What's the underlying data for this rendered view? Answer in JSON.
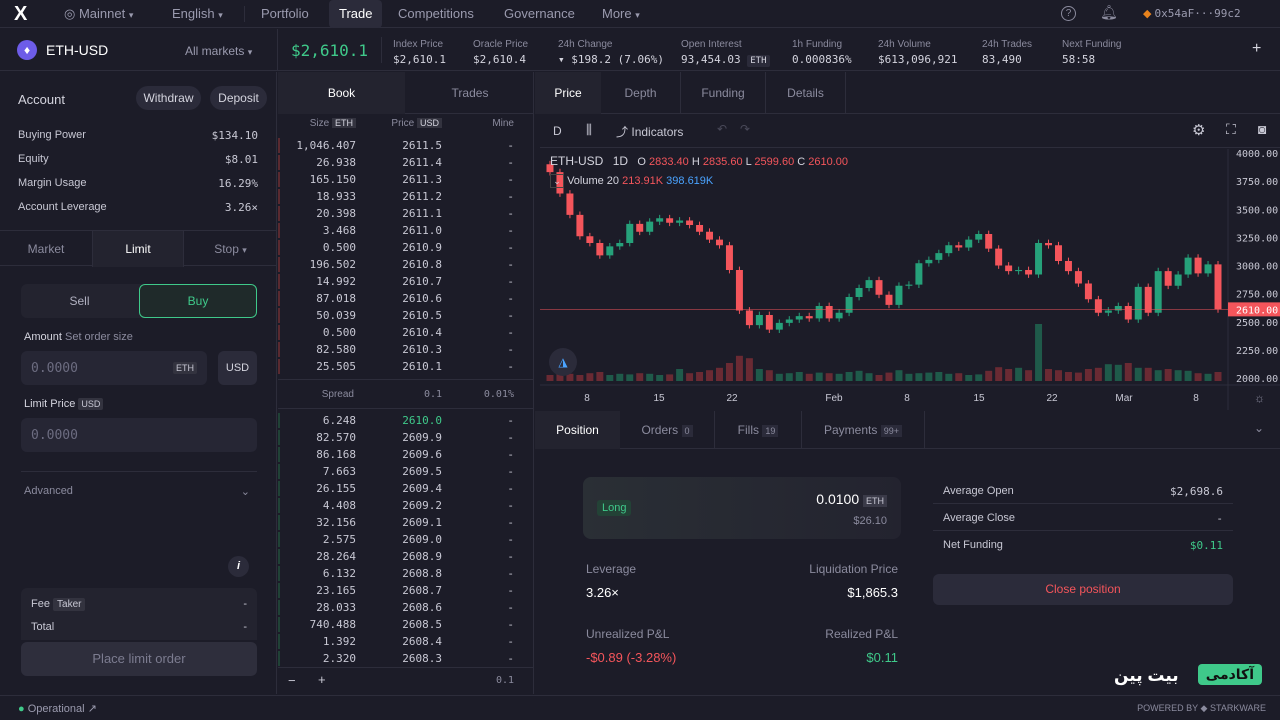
{
  "nav": {
    "network": "Mainnet",
    "language": "English",
    "items": [
      "Portfolio",
      "Trade",
      "Competitions",
      "Governance",
      "More"
    ],
    "wallet": "0x54aF···99c2"
  },
  "market": {
    "pair": "ETH-USD",
    "all_markets": "All markets",
    "price": "$2,610.1",
    "stats": [
      {
        "label": "Index Price",
        "value": "$2,610.1"
      },
      {
        "label": "Oracle Price",
        "value": "$2,610.4"
      },
      {
        "label": "24h Change",
        "value": "▾ $198.2 (7.06%)"
      },
      {
        "label": "Open Interest",
        "value": "93,454.03",
        "unit": "ETH"
      },
      {
        "label": "1h Funding",
        "value": "0.000836%"
      },
      {
        "label": "24h Volume",
        "value": "$613,096,921"
      },
      {
        "label": "24h Trades",
        "value": "83,490"
      },
      {
        "label": "Next Funding",
        "value": "58:58"
      }
    ]
  },
  "account": {
    "title": "Account",
    "withdraw": "Withdraw",
    "deposit": "Deposit",
    "rows": [
      {
        "k": "Buying Power",
        "v": "$134.10"
      },
      {
        "k": "Equity",
        "v": "$8.01"
      },
      {
        "k": "Margin Usage",
        "v": "16.29%"
      },
      {
        "k": "Account Leverage",
        "v": "3.26×"
      }
    ]
  },
  "order": {
    "tabs": [
      "Market",
      "Limit",
      "Stop"
    ],
    "sell": "Sell",
    "buy": "Buy",
    "amount_label": "Amount",
    "amount_hint": "Set order size",
    "amount_placeholder": "0.0000",
    "eth": "ETH",
    "usd": "USD",
    "limit_label": "Limit Price",
    "limit_unit": "USD",
    "limit_placeholder": "0.0000",
    "advanced": "Advanced",
    "fee": "Fee",
    "taker": "Taker",
    "fee_val": "-",
    "total": "Total",
    "total_val": "-",
    "place": "Place limit order"
  },
  "book": {
    "tabs": [
      "Book",
      "Trades"
    ],
    "h_size": "Size",
    "h_size_unit": "ETH",
    "h_price": "Price",
    "h_price_unit": "USD",
    "h_mine": "Mine",
    "asks": [
      [
        "1,046.407",
        "2611.5"
      ],
      [
        "26.938",
        "2611.4"
      ],
      [
        "165.150",
        "2611.3"
      ],
      [
        "18.933",
        "2611.2"
      ],
      [
        "20.398",
        "2611.1"
      ],
      [
        "3.468",
        "2611.0"
      ],
      [
        "0.500",
        "2610.9"
      ],
      [
        "196.502",
        "2610.8"
      ],
      [
        "14.992",
        "2610.7"
      ],
      [
        "87.018",
        "2610.6"
      ],
      [
        "50.039",
        "2610.5"
      ],
      [
        "0.500",
        "2610.4"
      ],
      [
        "82.580",
        "2610.3"
      ],
      [
        "25.505",
        "2610.1"
      ]
    ],
    "spread_label": "Spread",
    "spread": "0.1",
    "spread_pct": "0.01%",
    "bids": [
      [
        "6.248",
        "2610.0"
      ],
      [
        "82.570",
        "2609.9"
      ],
      [
        "86.168",
        "2609.6"
      ],
      [
        "7.663",
        "2609.5"
      ],
      [
        "26.155",
        "2609.4"
      ],
      [
        "4.408",
        "2609.2"
      ],
      [
        "32.156",
        "2609.1"
      ],
      [
        "2.575",
        "2609.0"
      ],
      [
        "28.264",
        "2608.9"
      ],
      [
        "6.132",
        "2608.8"
      ],
      [
        "23.165",
        "2608.7"
      ],
      [
        "28.033",
        "2608.6"
      ],
      [
        "740.488",
        "2608.5"
      ],
      [
        "1.392",
        "2608.4"
      ],
      [
        "2.320",
        "2608.3"
      ]
    ],
    "mine": "-",
    "tick": "0.1"
  },
  "chart": {
    "tabs": [
      "Price",
      "Depth",
      "Funding",
      "Details"
    ],
    "interval": "D",
    "indicators": "Indicators",
    "symbol": "ETH-USD",
    "tf": "1D",
    "ohlc": {
      "o": "2833.40",
      "h": "2835.60",
      "l": "2599.60",
      "c": "2610.00"
    },
    "vol_label": "Volume 20",
    "vol1": "213.91K",
    "vol2": "398.619K",
    "yticks": [
      "4000.00",
      "3750.00",
      "3500.00",
      "3250.00",
      "3000.00",
      "2750.00",
      "2500.00",
      "2250.00",
      "2000.00"
    ],
    "last": "2610.00",
    "xticks": [
      "8",
      "15",
      "22",
      "Feb",
      "8",
      "15",
      "22",
      "Mar",
      "8"
    ]
  },
  "chart_data": {
    "type": "candlestick",
    "ylim": [
      2000,
      4000
    ],
    "closes": [
      3830,
      3640,
      3450,
      3260,
      3200,
      3090,
      3170,
      3200,
      3370,
      3300,
      3390,
      3420,
      3380,
      3400,
      3360,
      3300,
      3230,
      3180,
      2960,
      2600,
      2470,
      2560,
      2430,
      2490,
      2520,
      2550,
      2530,
      2640,
      2530,
      2580,
      2720,
      2800,
      2870,
      2740,
      2650,
      2820,
      2830,
      3020,
      3050,
      3110,
      3180,
      3160,
      3230,
      3280,
      3150,
      3000,
      2950,
      2960,
      2920,
      3200,
      3180,
      3040,
      2950,
      2840,
      2700,
      2580,
      2600,
      2640,
      2520,
      2810,
      2580,
      2950,
      2820,
      2920,
      3070,
      2930,
      3010,
      2610
    ],
    "volumes": [
      0.1,
      0.15,
      0.12,
      0.1,
      0.13,
      0.15,
      0.1,
      0.12,
      0.11,
      0.13,
      0.12,
      0.1,
      0.11,
      0.2,
      0.13,
      0.15,
      0.18,
      0.22,
      0.3,
      0.42,
      0.38,
      0.2,
      0.18,
      0.12,
      0.13,
      0.15,
      0.12,
      0.14,
      0.13,
      0.12,
      0.15,
      0.17,
      0.13,
      0.1,
      0.14,
      0.18,
      0.12,
      0.13,
      0.14,
      0.15,
      0.12,
      0.13,
      0.1,
      0.11,
      0.17,
      0.23,
      0.2,
      0.22,
      0.18,
      0.95,
      0.2,
      0.18,
      0.15,
      0.14,
      0.2,
      0.22,
      0.28,
      0.27,
      0.3,
      0.22,
      0.22,
      0.18,
      0.2,
      0.18,
      0.17,
      0.13,
      0.12,
      0.15
    ]
  },
  "positions": {
    "tabs": [
      {
        "l": "Position",
        "c": ""
      },
      {
        "l": "Orders",
        "c": "0"
      },
      {
        "l": "Fills",
        "c": "19"
      },
      {
        "l": "Payments",
        "c": "99+"
      }
    ],
    "side": "Long",
    "size": "0.0100",
    "size_unit": "ETH",
    "notional": "$26.10",
    "leverage_l": "Leverage",
    "leverage": "3.26×",
    "liq_l": "Liquidation Price",
    "liq": "$1,865.3",
    "upnl_l": "Unrealized P&L",
    "upnl": "-$0.89 (-3.28%)",
    "rpnl_l": "Realized P&L",
    "rpnl": "$0.11",
    "details": [
      {
        "k": "Average Open",
        "v": "$2,698.6"
      },
      {
        "k": "Average Close",
        "v": "-"
      },
      {
        "k": "Net Funding",
        "v": "$0.11"
      }
    ],
    "close": "Close position"
  },
  "footer": {
    "status": "Operational",
    "powered": "POWERED BY",
    "brand": "STARKWARE",
    "watermark": "بیت پین",
    "watermark2": "آکادمی"
  }
}
